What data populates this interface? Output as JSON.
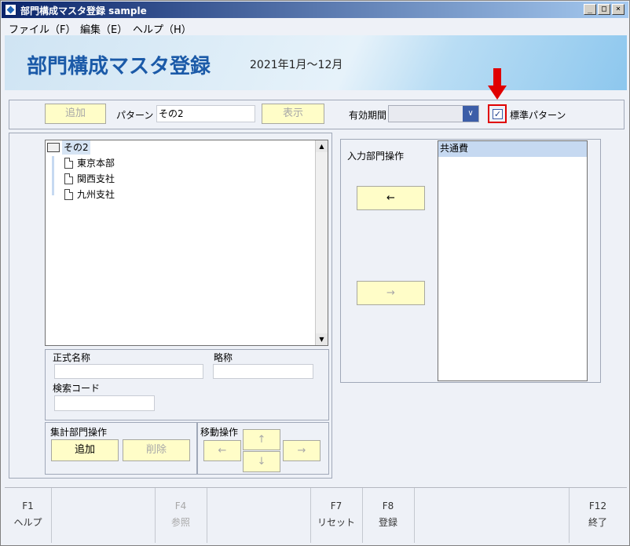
{
  "window": {
    "title": "部門構成マスタ登録 sample",
    "minimize": "_",
    "maximize": "□",
    "close": "×"
  },
  "menu": [
    "ファイル（F）",
    "編集（E）",
    "ヘルプ（H）"
  ],
  "header": {
    "title": "部門構成マスタ登録",
    "period": "2021年1月～12月"
  },
  "toolbar": {
    "add_label": "追加",
    "pattern_label": "パターン",
    "pattern_value": "その2",
    "show_label": "表示",
    "valid_period_label": "有効期間",
    "valid_period_value": "",
    "standard_pattern_label": "標準パターン",
    "standard_pattern_checked": true
  },
  "tree": {
    "root": "その2",
    "children": [
      "東京本部",
      "関西支社",
      "九州支社"
    ]
  },
  "detail": {
    "official_name_label": "正式名称",
    "official_name_value": "",
    "short_name_label": "略称",
    "short_name_value": "",
    "search_code_label": "検索コード",
    "search_code_value": ""
  },
  "aggregate_ops": {
    "label": "集計部門操作",
    "add": "追加",
    "delete": "削除"
  },
  "move_ops": {
    "label": "移動操作",
    "up": "↑",
    "down": "↓",
    "left": "←",
    "right": "→"
  },
  "input_ops": {
    "label": "入力部門操作",
    "left": "←",
    "right": "→"
  },
  "list": {
    "items": [
      "共通費"
    ],
    "selected_index": 0
  },
  "fkeys": [
    {
      "key": "F1",
      "label": "ヘルプ",
      "enabled": true
    },
    {
      "key": "F4",
      "label": "参照",
      "enabled": false
    },
    {
      "key": "F7",
      "label": "リセット",
      "enabled": true
    },
    {
      "key": "F8",
      "label": "登録",
      "enabled": true
    },
    {
      "key": "F12",
      "label": "終了",
      "enabled": true
    }
  ],
  "colors": {
    "accent": "#1b5aa8",
    "button_yellow": "#fffdc8",
    "highlight_red": "#e00000",
    "selected_row": "#c6d9f1"
  }
}
